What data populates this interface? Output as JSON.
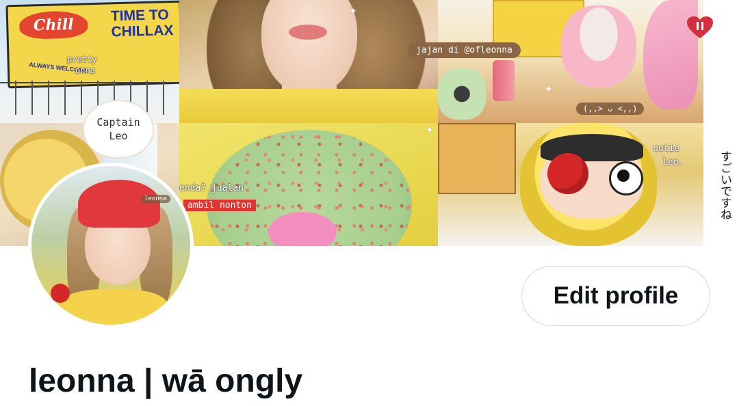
{
  "banner": {
    "billboard_logo": "Chill",
    "billboard_title": "TIME TO CHILLAX",
    "billboard_tag": "ALWAYS WELCOME",
    "stickers": {
      "pretty": "pretty",
      "onna": "onna",
      "captain_line1": "Captain",
      "captain_line2": "Leo",
      "jajan": "jajan di @ofleonna",
      "kaomoji": "(,,> ᴗ <,,)",
      "enda": "enda? jualan",
      "nonton": "ambil nonton",
      "cutie": "cutie",
      "leo": "leo.",
      "japanese": "すごいですね",
      "avatar_label": "leonna"
    }
  },
  "profile": {
    "edit_button_label": "Edit profile",
    "display_name": "leonna | wā ongly"
  },
  "colors": {
    "heart": "#d42e3f",
    "text_primary": "#0f1419",
    "button_border": "#cfd9de"
  }
}
